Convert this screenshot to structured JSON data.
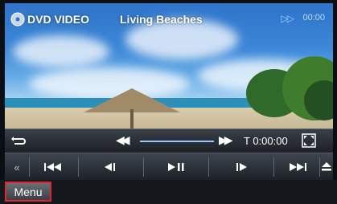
{
  "header": {
    "source_label": "DVD VIDEO",
    "disc_title": "Living Beaches",
    "play_status_icon": "play-indicator-icon",
    "time_readout": "00:00"
  },
  "progress": {
    "time": "T 0:00:00"
  },
  "controls": {
    "repeat_icon": "repeat-icon",
    "seek_back_icon": "rewind-icon",
    "seek_forward_icon": "fast-forward-icon",
    "fullscreen_icon": "fullscreen-icon",
    "buttons": [
      {
        "name": "collapse-button",
        "glyph": "«"
      },
      {
        "name": "previous-chapter-button",
        "glyph": "⏮"
      },
      {
        "name": "slow-back-button",
        "glyph": "◀▏"
      },
      {
        "name": "play-pause-button",
        "glyph": "▶⏸"
      },
      {
        "name": "slow-forward-button",
        "glyph": "▕▶"
      },
      {
        "name": "next-chapter-button",
        "glyph": "⏭"
      },
      {
        "name": "eject-button",
        "glyph": "⏏"
      }
    ]
  },
  "menu": {
    "label": "Menu"
  },
  "colors": {
    "highlight_border": "#e0262c",
    "accent": "#8ec8ff"
  }
}
